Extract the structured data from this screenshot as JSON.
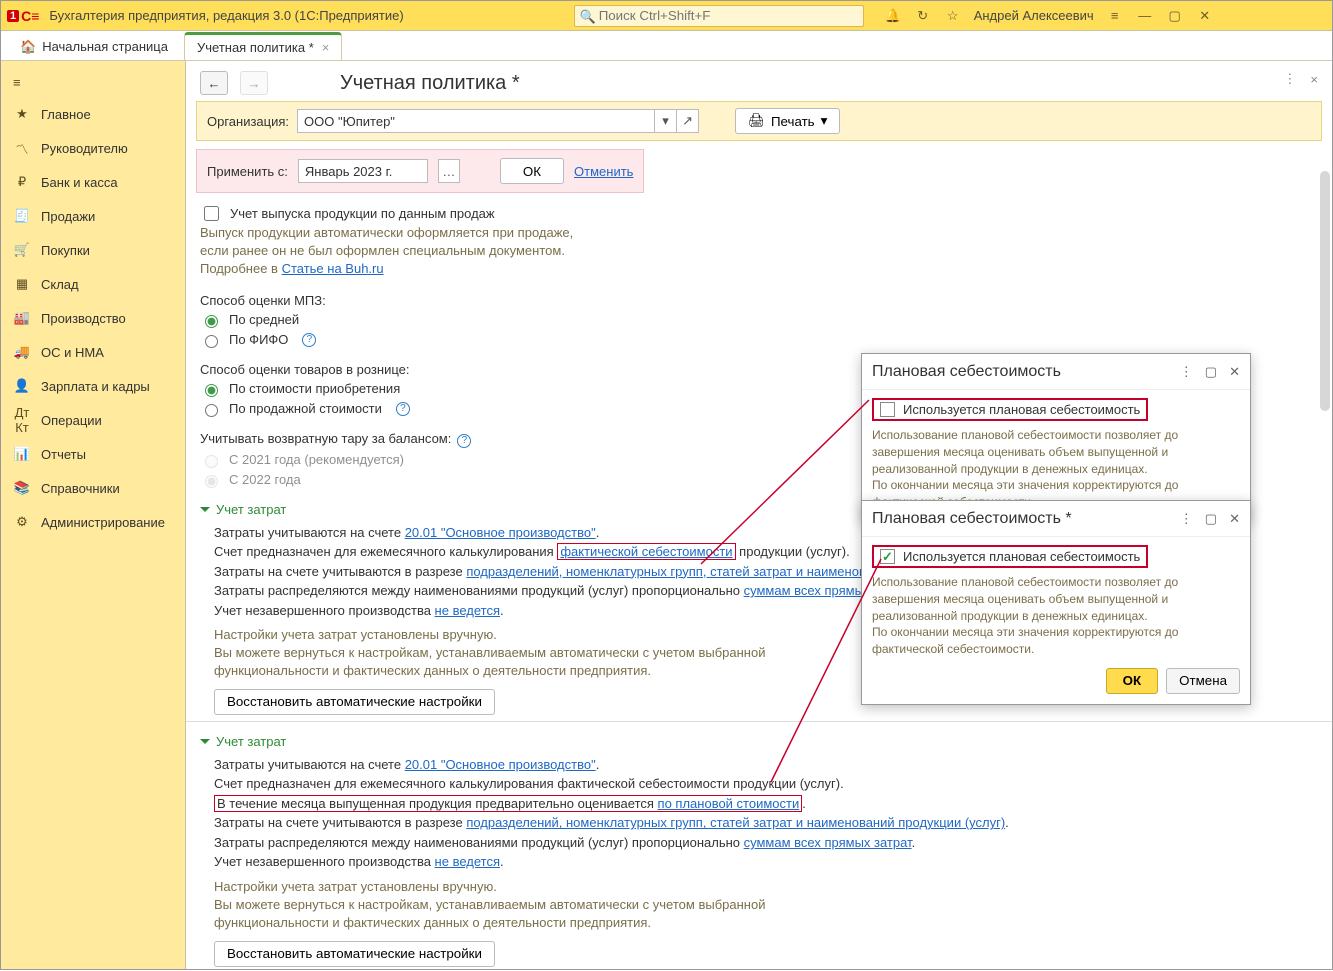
{
  "app": {
    "title": "Бухгалтерия предприятия, редакция 3.0  (1С:Предприятие)",
    "search_placeholder": "Поиск Ctrl+Shift+F",
    "user": "Андрей Алексеевич"
  },
  "tabs": {
    "home": "Начальная страница",
    "active": "Учетная политика *"
  },
  "sidebar": {
    "items": [
      "Главное",
      "Руководителю",
      "Банк и касса",
      "Продажи",
      "Покупки",
      "Склад",
      "Производство",
      "ОС и НМА",
      "Зарплата и кадры",
      "Операции",
      "Отчеты",
      "Справочники",
      "Администрирование"
    ],
    "icons": [
      "★",
      "〽",
      "₽",
      "🧾",
      "🛒",
      "▦",
      "🏭",
      "🚚",
      "👤",
      "Дт\nКт",
      "📊",
      "📚",
      "⚙"
    ]
  },
  "page": {
    "title": "Учетная политика *",
    "org_label": "Организация:",
    "org_value": "ООО \"Юпитер\"",
    "print": "Печать",
    "apply_label": "Применить с:",
    "apply_date": "Январь 2023 г.",
    "ok": "ОК",
    "cancel": "Отменить"
  },
  "form": {
    "chk_sales": "Учет выпуска продукции по данным продаж",
    "hint_sales1": "Выпуск продукции автоматически оформляется при продаже,",
    "hint_sales2": "если ранее он не был оформлен специальным документом.",
    "hint_sales3": "Подробнее в ",
    "hint_sales_link": "Статье на Buh.ru",
    "mpz_label": "Способ оценки МПЗ:",
    "mpz_opt1": "По средней",
    "mpz_opt2": "По ФИФО",
    "retail_label": "Способ оценки товаров в рознице:",
    "retail_opt1": "По стоимости приобретения",
    "retail_opt2": "По продажной стоимости",
    "tara_label": "Учитывать возвратную тару за балансом:",
    "tara_opt1": "С 2021 года (рекомендуется)",
    "tara_opt2": "С 2022 года",
    "expander": "Учет затрат",
    "cost": {
      "l1a": "Затраты учитываются на счете ",
      "l1b": "20.01 \"Основное производство\"",
      "l1c": ".",
      "l2a": "Счет предназначен для ежемесячного калькулирования ",
      "l2b": "фактической себестоимости",
      "l2c": " продукции (услуг).",
      "l3a": "Затраты на счете учитываются в разрезе ",
      "l3b": "подразделений, номенклатурных групп, статей затрат и наименований пр",
      "l4a": "Затраты распределяются между наименованиями продукций (услуг) пропорционально ",
      "l4b": "суммам всех прямых затра",
      "l5a": "Учет незавершенного производства ",
      "l5b": "не ведется",
      "l5c": ".",
      "h1": "Настройки учета затрат установлены вручную.",
      "h2": "Вы можете вернуться к настройкам, устанавливаемым автоматически с учетом выбранной",
      "h3": "функциональности и фактических данных о деятельности предприятия.",
      "restore": "Восстановить автоматические настройки"
    },
    "cost2": {
      "l2": "Счет предназначен для ежемесячного калькулирования фактической себестоимости продукции (услуг).",
      "l_extra_a": "В течение месяца выпущенная продукция предварительно оценивается ",
      "l_extra_b": "по плановой стоимости",
      "l_extra_c": ".",
      "l3b": "подразделений, номенклатурных групп, статей затрат и наименований продукции (услуг)",
      "l4b": "суммам всех прямых затрат"
    }
  },
  "popup": {
    "title1": "Плановая себестоимость",
    "title2": "Плановая себестоимость *",
    "chk_label": "Используется плановая себестоимость",
    "hint1": "Использование плановой себестоимости позволяет до",
    "hint2": "завершения месяца оценивать объем выпущенной и",
    "hint3": "реализованной продукции в денежных единицах.",
    "hint4": "По окончании месяца эти значения корректируются до",
    "hint5": "фактической себестоимости.",
    "ok": "ОК",
    "cancel": "Отмена"
  }
}
